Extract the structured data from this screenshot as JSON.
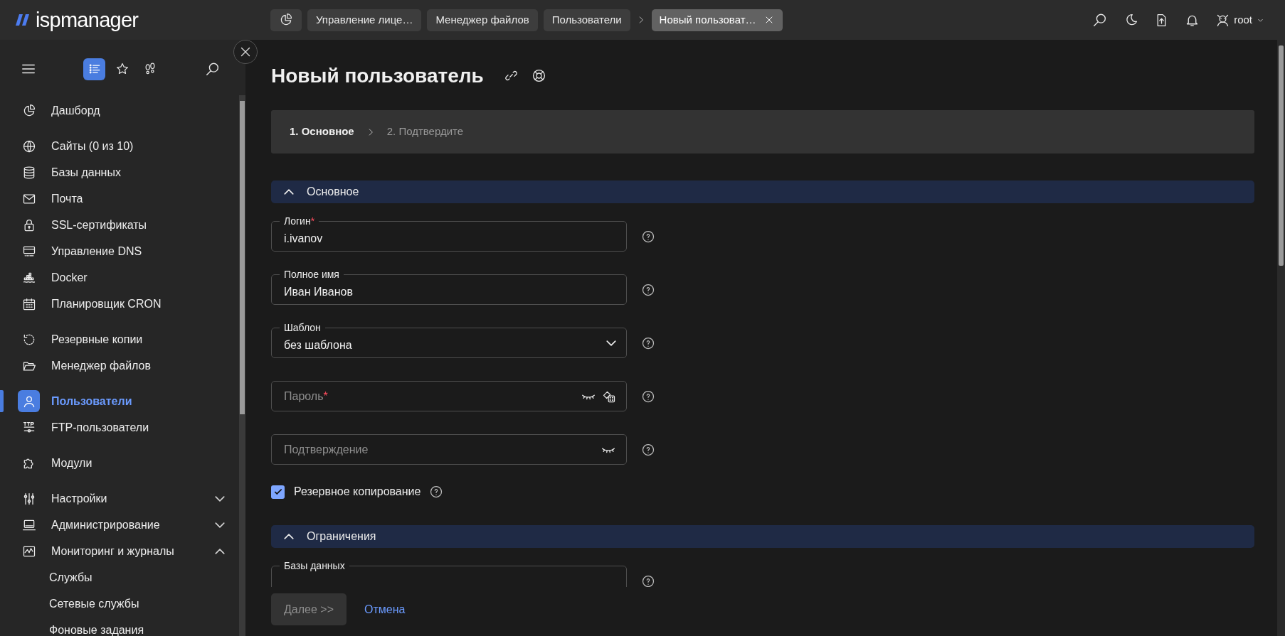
{
  "app": {
    "logo_text": "ispmanager"
  },
  "breadcrumbs": [
    {
      "label": "Управление лице…",
      "selected": false
    },
    {
      "label": "Менеджер файлов",
      "selected": false
    },
    {
      "label": "Пользователи",
      "selected": false
    },
    {
      "label": "Новый пользоват…",
      "selected": true
    }
  ],
  "user_menu": {
    "label": "root"
  },
  "sidebar": {
    "view_tabs": [
      {
        "selected": true
      },
      {
        "selected": false
      },
      {
        "selected": false
      }
    ],
    "groups": [
      [
        {
          "label": "Дашборд",
          "selected": false
        }
      ],
      [
        {
          "label": "Сайты (0 из 10)",
          "selected": false
        },
        {
          "label": "Базы данных",
          "selected": false
        },
        {
          "label": "Почта",
          "selected": false
        },
        {
          "label": "SSL-сертификаты",
          "selected": false
        },
        {
          "label": "Управление DNS",
          "selected": false
        },
        {
          "label": "Docker",
          "selected": false
        },
        {
          "label": "Планировщик CRON",
          "selected": false
        }
      ],
      [
        {
          "label": "Резервные копии",
          "selected": false
        },
        {
          "label": "Менеджер файлов",
          "selected": false
        }
      ],
      [
        {
          "label": "Пользователи",
          "selected": true
        },
        {
          "label": "FTP-пользователи",
          "selected": false
        }
      ],
      [
        {
          "label": "Модули",
          "selected": false
        }
      ],
      [
        {
          "label": "Настройки",
          "selected": false,
          "expanded": false
        },
        {
          "label": "Администрирование",
          "selected": false,
          "expanded": false
        },
        {
          "label": "Мониторинг и журналы",
          "selected": false,
          "expanded": true,
          "children": [
            {
              "label": "Службы",
              "selected": false
            },
            {
              "label": "Сетевые службы",
              "selected": false
            },
            {
              "label": "Фоновые задания",
              "selected": false
            }
          ]
        }
      ]
    ]
  },
  "page": {
    "title": "Новый пользователь",
    "steps": [
      {
        "label": "1. Основное",
        "selected": true
      },
      {
        "label": "2. Подтвердите",
        "selected": false
      }
    ],
    "sections": [
      {
        "title": "Основное",
        "expanded": true,
        "fields": [
          {
            "kind": "text",
            "label": "Логин",
            "required_mark": "*",
            "value": "i.ivanov"
          },
          {
            "kind": "text",
            "label": "Полное имя",
            "value": "Иван Иванов"
          },
          {
            "kind": "select",
            "label": "Шаблон",
            "value": "без шаблона"
          },
          {
            "kind": "password",
            "placeholder": "Пароль",
            "required_mark": "*",
            "generator": true
          },
          {
            "kind": "password",
            "placeholder": "Подтверждение",
            "generator": false
          },
          {
            "kind": "checkbox",
            "label": "Резервное копирование",
            "checked": true
          }
        ]
      },
      {
        "title": "Ограничения",
        "expanded": true,
        "fields": [
          {
            "kind": "text",
            "label": "Базы данных"
          }
        ]
      }
    ],
    "footer": {
      "next_button": {
        "label": "Далее >>",
        "disabled": true
      },
      "cancel_link": "Отмена"
    }
  }
}
